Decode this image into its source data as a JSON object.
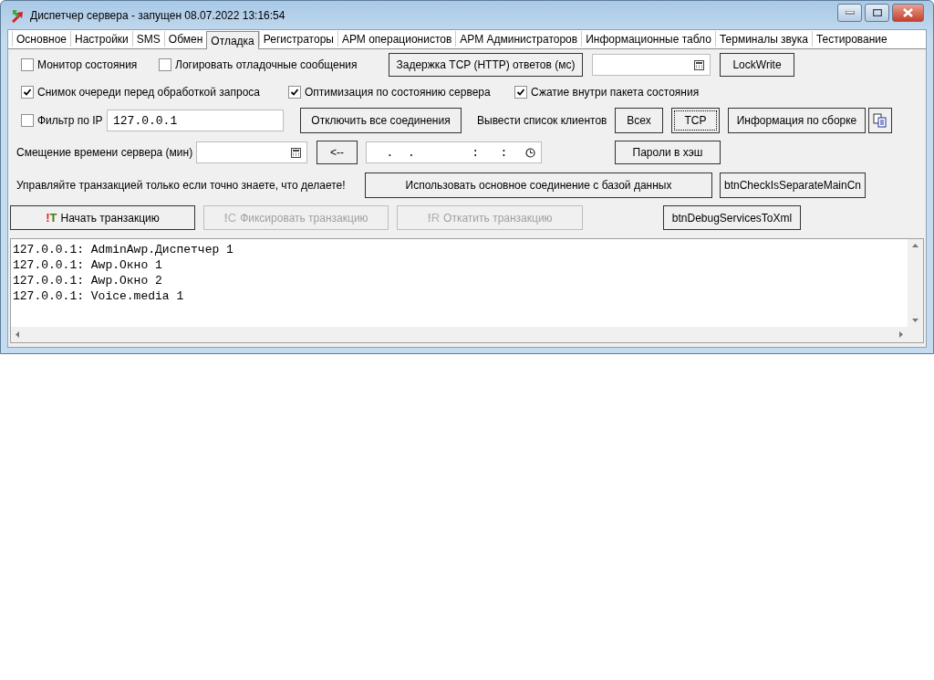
{
  "window": {
    "title": "Диспетчер сервера - запущен 08.07.2022 13:16:54"
  },
  "tabs": [
    {
      "label": "Основное",
      "selected": false
    },
    {
      "label": "Настройки",
      "selected": false
    },
    {
      "label": "SMS",
      "selected": false
    },
    {
      "label": "Обмен",
      "selected": false
    },
    {
      "label": "Отладка",
      "selected": true
    },
    {
      "label": "Регистраторы",
      "selected": false
    },
    {
      "label": "АРМ операционистов",
      "selected": false
    },
    {
      "label": "АРМ Администраторов",
      "selected": false
    },
    {
      "label": "Информационные табло",
      "selected": false
    },
    {
      "label": "Терминалы звука",
      "selected": false
    },
    {
      "label": "Тестирование",
      "selected": false
    }
  ],
  "rows": [
    [
      {
        "kind": "checkbox",
        "label": "Монитор состояния",
        "checked": false
      },
      {
        "kind": "checkbox",
        "label": "Логировать отладочные сообщения",
        "checked": false
      },
      {
        "kind": "button",
        "label": "Задержка TCP (HTTP) ответов (мс)",
        "disabled": false,
        "focused": false
      },
      {
        "kind": "numeric"
      },
      {
        "kind": "button",
        "label": "LockWrite",
        "disabled": false,
        "focused": false
      }
    ],
    [
      {
        "kind": "checkbox",
        "label": "Снимок очереди перед обработкой запроса",
        "checked": true
      },
      {
        "kind": "checkbox",
        "label": "Оптимизация по состоянию сервера",
        "checked": true
      },
      {
        "kind": "checkbox",
        "label": "Сжатие внутри пакета состояния",
        "checked": true
      }
    ],
    [
      {
        "kind": "checkbox",
        "label": "Фильтр по IP",
        "checked": false
      },
      {
        "kind": "text",
        "value": "127.0.0.1"
      },
      {
        "kind": "button",
        "label": "Отключить все соединения",
        "disabled": false,
        "focused": false
      },
      {
        "kind": "label",
        "label": "Вывести список клиентов"
      },
      {
        "kind": "button",
        "label": "Всех",
        "disabled": false,
        "focused": false
      },
      {
        "kind": "button",
        "label": "TCP",
        "disabled": false,
        "focused": true
      },
      {
        "kind": "button",
        "label": "Информация по сборке",
        "disabled": false,
        "focused": false
      },
      {
        "kind": "iconbutton"
      }
    ],
    [
      {
        "kind": "label",
        "label": "Смещение времени сервера (мин)"
      },
      {
        "kind": "numeric"
      },
      {
        "kind": "button",
        "label": "<--",
        "disabled": false,
        "focused": false
      },
      {
        "kind": "datetime",
        "value": "  .  .        :   :"
      },
      {
        "kind": "button",
        "label": "Пароли в хэш",
        "disabled": false,
        "focused": false
      }
    ],
    [
      {
        "kind": "label",
        "label": "Управляйте транзакцией только если точно знаете, что делаете!"
      },
      {
        "kind": "button",
        "label": "Использовать основное соединение с базой данных",
        "disabled": false,
        "focused": false
      },
      {
        "kind": "button",
        "label": "btnCheckIsSeparateMainCn",
        "disabled": false,
        "focused": false
      }
    ],
    [
      {
        "kind": "button",
        "badge": "!T",
        "label": "Начать транзакцию",
        "disabled": false,
        "focused": false
      },
      {
        "kind": "button",
        "badge": "!C",
        "label": "Фиксировать транзакцию",
        "disabled": true,
        "focused": false
      },
      {
        "kind": "button",
        "badge": "!R",
        "label": "Откатить транзакцию",
        "disabled": true,
        "focused": false
      },
      {
        "kind": "button",
        "label": "btnDebugServicesToXml",
        "disabled": false,
        "focused": false
      }
    ]
  ],
  "log": [
    "127.0.0.1: AdminAwp.Диспетчер 1",
    "127.0.0.1: Awp.Окно 1",
    "127.0.0.1: Awp.Окно 2",
    "127.0.0.1: Voice.media 1"
  ]
}
